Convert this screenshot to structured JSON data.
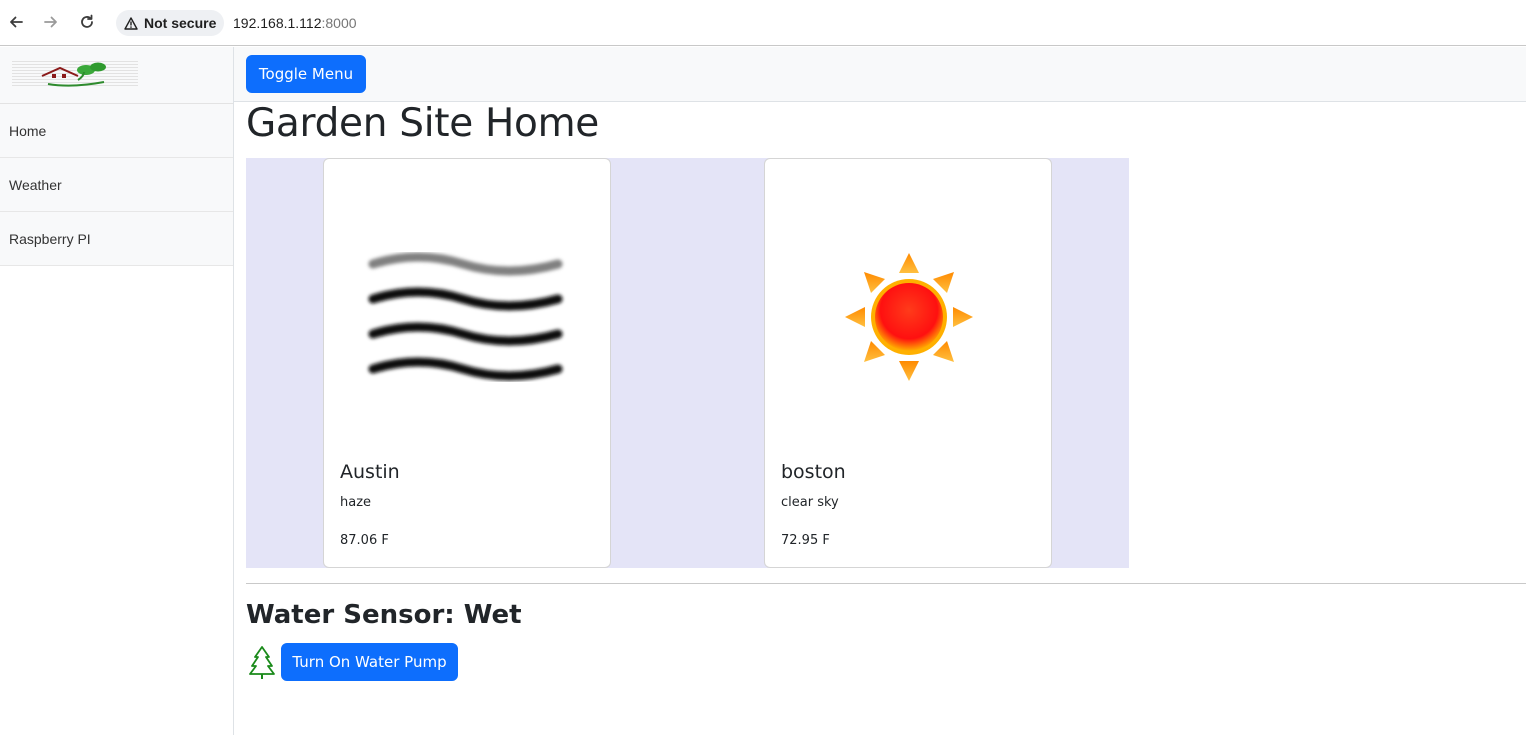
{
  "browser": {
    "security_label": "Not secure",
    "url_host": "192.168.1.112",
    "url_port": ":8000"
  },
  "sidebar": {
    "logo_icon": "garden-logo",
    "items": [
      {
        "label": "Home"
      },
      {
        "label": "Weather"
      },
      {
        "label": "Raspberry PI"
      }
    ]
  },
  "topbar": {
    "toggle_label": "Toggle Menu"
  },
  "main": {
    "title": "Garden Site Home",
    "weather_cards": [
      {
        "city": "Austin",
        "description": "haze",
        "temperature": "87.06 F",
        "icon": "haze-icon"
      },
      {
        "city": "boston",
        "description": "clear sky",
        "temperature": "72.95 F",
        "icon": "sun-icon"
      }
    ],
    "sensor_label": "Water Sensor: Wet",
    "pump_button_label": "Turn On Water Pump",
    "tree_icon": "tree-icon"
  },
  "colors": {
    "primary": "#0d6efd",
    "cards_background": "#e4e4f7",
    "sidebar_background": "#f8f9fa",
    "tree_green": "#1a8a1a"
  }
}
